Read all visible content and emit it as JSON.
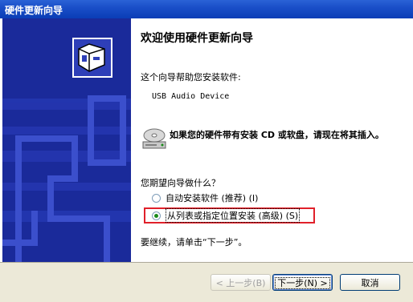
{
  "window": {
    "title": "硬件更新向导"
  },
  "main": {
    "heading": "欢迎使用硬件更新向导",
    "intro": "这个向导帮助您安装软件:",
    "device_name": "USB Audio Device",
    "cd_prompt": "如果您的硬件带有安装 CD 或软盘，请现在将其插入。",
    "question": "您期望向导做什么？",
    "options": [
      {
        "label": "自动安装软件 (推荐) (I)",
        "selected": false
      },
      {
        "label": "从列表或指定位置安装 (高级) (S)",
        "selected": true
      }
    ],
    "continue_text": "要继续，请单击“下一步”。"
  },
  "footer": {
    "back_label": "< 上一步(B)",
    "next_label": "下一步(N) >",
    "cancel_label": "取消"
  },
  "colors": {
    "title_bar": "#0a3db6",
    "left_panel": "#1a2a9a",
    "highlight_border": "#e0202a"
  }
}
